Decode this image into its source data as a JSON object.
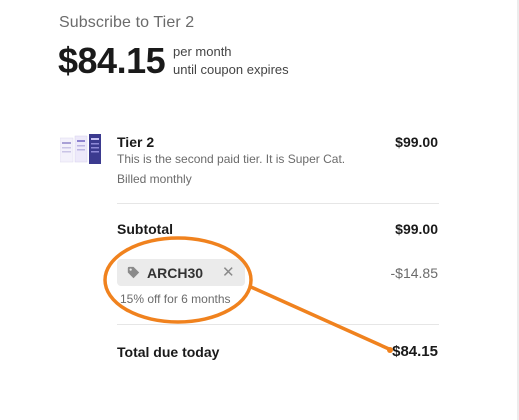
{
  "header": {
    "title": "Subscribe to Tier 2",
    "price": "$84.15",
    "price_line1": "per month",
    "price_line2": "until coupon expires"
  },
  "item": {
    "name": "Tier 2",
    "description": "This is the second paid tier. It is Super Cat.",
    "billing": "Billed monthly",
    "price": "$99.00"
  },
  "subtotal": {
    "label": "Subtotal",
    "value": "$99.00"
  },
  "coupon": {
    "code": "ARCH30",
    "close_glyph": "✕",
    "note": "15% off for 6 months",
    "discount": "-$14.85"
  },
  "total": {
    "label": "Total due today",
    "value": "$84.15"
  },
  "colors": {
    "annotation": "#F0821E",
    "pill_bg": "#EBEBEB",
    "divider": "#E6E6E6"
  }
}
